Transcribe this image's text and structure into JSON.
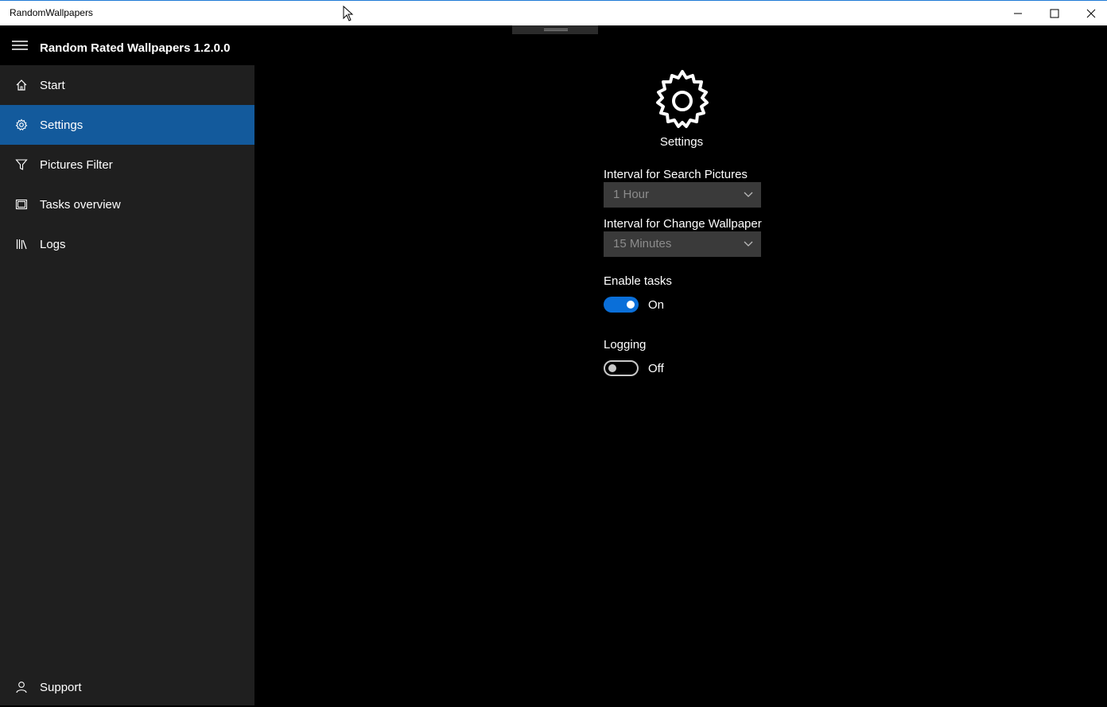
{
  "window": {
    "title": "RandomWallpapers",
    "minimize_icon": "minimize-icon",
    "maximize_icon": "maximize-icon",
    "close_icon": "close-icon"
  },
  "sidebar": {
    "app_name": "Random Rated Wallpapers 1.2.0.0",
    "menu_icon": "hamburger-icon",
    "items": [
      {
        "label": "Start",
        "icon": "home-icon",
        "active": false
      },
      {
        "label": "Settings",
        "icon": "gear-icon",
        "active": true
      },
      {
        "label": "Pictures Filter",
        "icon": "filter-icon",
        "active": false
      },
      {
        "label": "Tasks overview",
        "icon": "tasks-icon",
        "active": false
      },
      {
        "label": "Logs",
        "icon": "library-icon",
        "active": false
      }
    ],
    "footer": {
      "label": "Support",
      "icon": "person-icon"
    }
  },
  "main": {
    "title": "Settings",
    "title_icon": "gear-icon",
    "search_interval": {
      "label": "Interval for Search Pictures",
      "value": "1 Hour"
    },
    "change_interval": {
      "label": "Interval for Change Wallpaper",
      "value": "15 Minutes"
    },
    "enable_tasks": {
      "label": "Enable tasks",
      "state": "On",
      "checked": true
    },
    "logging": {
      "label": "Logging",
      "state": "Off",
      "checked": false
    }
  },
  "colors": {
    "accent": "#0a6fd9",
    "selected_nav": "#135a9c",
    "sidebar_bg": "#1f1f1f",
    "main_bg": "#000000"
  }
}
